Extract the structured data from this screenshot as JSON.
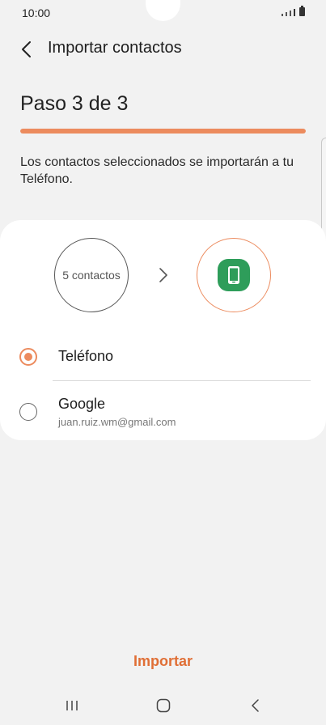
{
  "status_bar": {
    "time": "10:00"
  },
  "header": {
    "title": "Importar contactos"
  },
  "step": {
    "title": "Paso 3 de 3",
    "progress_fraction": 1.0
  },
  "description": "Los contactos seleccionados se importarán a tu Teléfono.",
  "transfer": {
    "source_label": "5 contactos"
  },
  "options": [
    {
      "label": "Teléfono",
      "selected": true
    },
    {
      "label": "Google",
      "subtitle": "juan.ruiz.wm@gmail.com",
      "selected": false
    }
  ],
  "actions": {
    "import_label": "Importar"
  },
  "colors": {
    "accent": "#ec8b5e",
    "accent_text": "#e06f36",
    "phone_app": "#2e9d5a"
  },
  "icons": {
    "back": "chevron-left-icon",
    "arrow": "chevron-right-icon",
    "target": "phone-icon",
    "nav_recents": "recents-icon",
    "nav_home": "home-icon",
    "nav_back": "back-icon"
  }
}
